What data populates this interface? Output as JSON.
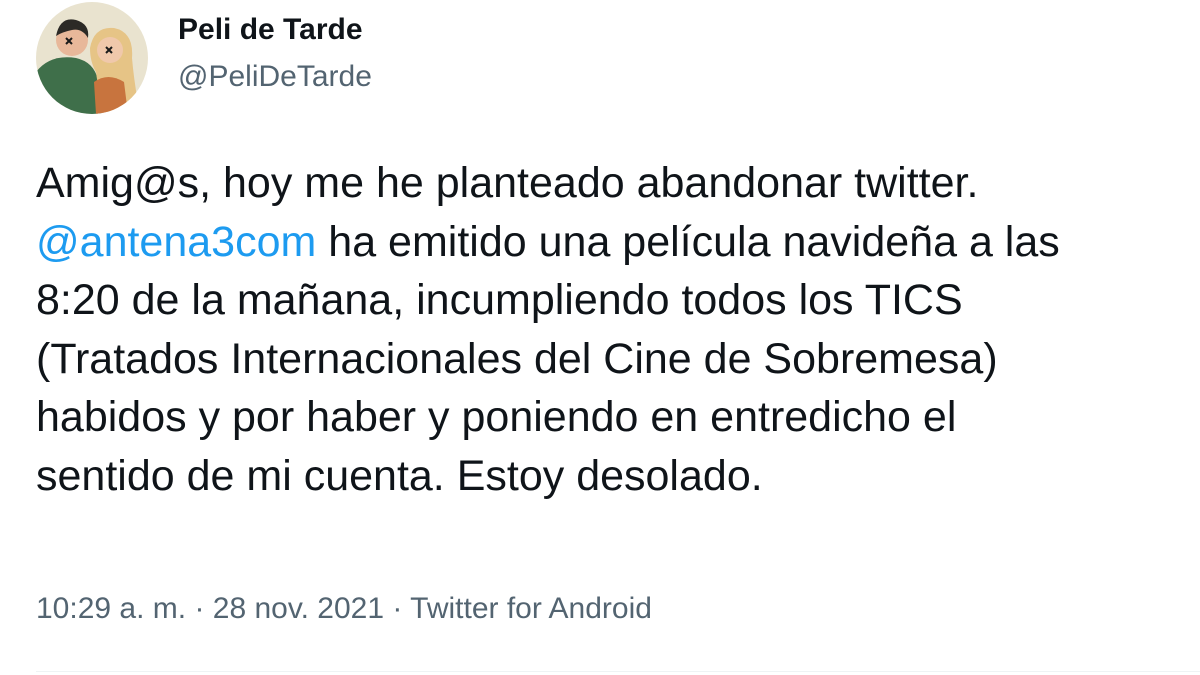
{
  "author": {
    "display_name": "Peli de Tarde",
    "handle": "@PeliDeTarde"
  },
  "tweet": {
    "lines": [
      {
        "parts": [
          {
            "text": "Amig@s, hoy me he planteado abandonar twitter."
          }
        ]
      },
      {
        "parts": [
          {
            "text": "@antena3com",
            "mention": true
          },
          {
            "text": " ha emitido una película navideña a las"
          }
        ]
      },
      {
        "parts": [
          {
            "text": "8:20 de la mañana, incumpliendo todos los TICS"
          }
        ]
      },
      {
        "parts": [
          {
            "text": "(Tratados Internacionales del Cine de Sobremesa)"
          }
        ]
      },
      {
        "parts": [
          {
            "text": "habidos y por haber y poniendo en entredicho el"
          }
        ]
      },
      {
        "parts": [
          {
            "text": "sentido de mi cuenta. Estoy desolado."
          }
        ]
      }
    ]
  },
  "meta": {
    "time": "10:29 a. m.",
    "separator": "·",
    "date": "28 nov. 2021",
    "source": "Twitter for Android"
  },
  "colors": {
    "text": "#0f1419",
    "secondary": "#536471",
    "mention": "#1d9bf0",
    "avatar_bg": "#e9e3cf"
  },
  "icons": {
    "avatar": "profile-avatar-illustration"
  }
}
